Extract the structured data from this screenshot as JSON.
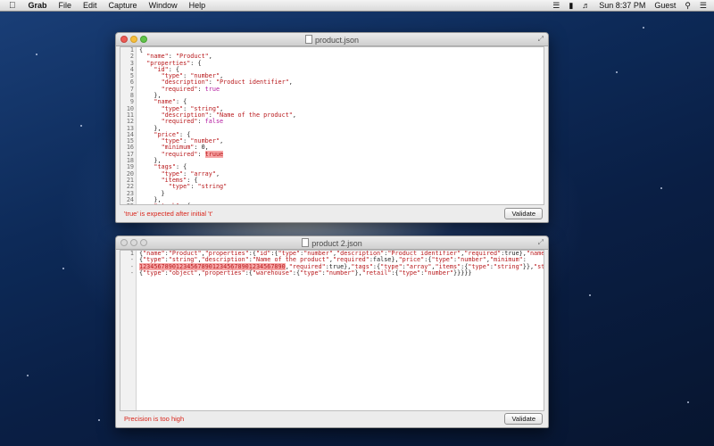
{
  "menubar": {
    "apple": "",
    "app_name": "Grab",
    "menus": [
      "File",
      "Edit",
      "Capture",
      "Window",
      "Help"
    ],
    "clock": "Sun 8:37 PM",
    "user": "Guest"
  },
  "windows": [
    {
      "title": "product.json",
      "active": true,
      "line_numbers": [
        "1",
        "2",
        "3",
        "4",
        "5",
        "6",
        "7",
        "8",
        "9",
        "10",
        "11",
        "12",
        "13",
        "14",
        "15",
        "16",
        "17",
        "18",
        "19",
        "20",
        "21",
        "22",
        "23",
        "24",
        "25",
        "26"
      ],
      "error_message": "'true' is expected after initial 't'",
      "validate_label": "Validate"
    },
    {
      "title": "product 2.json",
      "active": false,
      "line_numbers": [
        "1",
        "-",
        "-",
        "-"
      ],
      "error_message": "Precision is too high",
      "validate_label": "Validate"
    }
  ],
  "code1": [
    [
      {
        "t": "{",
        "c": "n"
      }
    ],
    [
      {
        "t": "  ",
        "c": "n"
      },
      {
        "t": "\"name\"",
        "c": "k"
      },
      {
        "t": ": ",
        "c": "n"
      },
      {
        "t": "\"Product\"",
        "c": "s"
      },
      {
        "t": ",",
        "c": "n"
      }
    ],
    [
      {
        "t": "  ",
        "c": "n"
      },
      {
        "t": "\"properties\"",
        "c": "k"
      },
      {
        "t": ": {",
        "c": "n"
      }
    ],
    [
      {
        "t": "    ",
        "c": "n"
      },
      {
        "t": "\"id\"",
        "c": "k"
      },
      {
        "t": ": {",
        "c": "n"
      }
    ],
    [
      {
        "t": "      ",
        "c": "n"
      },
      {
        "t": "\"type\"",
        "c": "k"
      },
      {
        "t": ": ",
        "c": "n"
      },
      {
        "t": "\"number\"",
        "c": "s"
      },
      {
        "t": ",",
        "c": "n"
      }
    ],
    [
      {
        "t": "      ",
        "c": "n"
      },
      {
        "t": "\"description\"",
        "c": "k"
      },
      {
        "t": ": ",
        "c": "n"
      },
      {
        "t": "\"Product identifier\"",
        "c": "s"
      },
      {
        "t": ",",
        "c": "n"
      }
    ],
    [
      {
        "t": "      ",
        "c": "n"
      },
      {
        "t": "\"required\"",
        "c": "k"
      },
      {
        "t": ": ",
        "c": "n"
      },
      {
        "t": "true",
        "c": "b"
      }
    ],
    [
      {
        "t": "    },",
        "c": "n"
      }
    ],
    [
      {
        "t": "    ",
        "c": "n"
      },
      {
        "t": "\"name\"",
        "c": "k"
      },
      {
        "t": ": {",
        "c": "n"
      }
    ],
    [
      {
        "t": "      ",
        "c": "n"
      },
      {
        "t": "\"type\"",
        "c": "k"
      },
      {
        "t": ": ",
        "c": "n"
      },
      {
        "t": "\"string\"",
        "c": "s"
      },
      {
        "t": ",",
        "c": "n"
      }
    ],
    [
      {
        "t": "      ",
        "c": "n"
      },
      {
        "t": "\"description\"",
        "c": "k"
      },
      {
        "t": ": ",
        "c": "n"
      },
      {
        "t": "\"Name of the product\"",
        "c": "s"
      },
      {
        "t": ",",
        "c": "n"
      }
    ],
    [
      {
        "t": "      ",
        "c": "n"
      },
      {
        "t": "\"required\"",
        "c": "k"
      },
      {
        "t": ": ",
        "c": "n"
      },
      {
        "t": "false",
        "c": "b"
      }
    ],
    [
      {
        "t": "    },",
        "c": "n"
      }
    ],
    [
      {
        "t": "    ",
        "c": "n"
      },
      {
        "t": "\"price\"",
        "c": "k"
      },
      {
        "t": ": {",
        "c": "n"
      }
    ],
    [
      {
        "t": "      ",
        "c": "n"
      },
      {
        "t": "\"type\"",
        "c": "k"
      },
      {
        "t": ": ",
        "c": "n"
      },
      {
        "t": "\"number\"",
        "c": "s"
      },
      {
        "t": ",",
        "c": "n"
      }
    ],
    [
      {
        "t": "      ",
        "c": "n"
      },
      {
        "t": "\"minimum\"",
        "c": "k"
      },
      {
        "t": ": 0,",
        "c": "n"
      }
    ],
    [
      {
        "t": "      ",
        "c": "n"
      },
      {
        "t": "\"required\"",
        "c": "k"
      },
      {
        "t": ": ",
        "c": "n"
      },
      {
        "t": "truue",
        "c": "err"
      }
    ],
    [
      {
        "t": "    },",
        "c": "n"
      }
    ],
    [
      {
        "t": "    ",
        "c": "n"
      },
      {
        "t": "\"tags\"",
        "c": "k"
      },
      {
        "t": ": {",
        "c": "n"
      }
    ],
    [
      {
        "t": "      ",
        "c": "n"
      },
      {
        "t": "\"type\"",
        "c": "k"
      },
      {
        "t": ": ",
        "c": "n"
      },
      {
        "t": "\"array\"",
        "c": "s"
      },
      {
        "t": ",",
        "c": "n"
      }
    ],
    [
      {
        "t": "      ",
        "c": "n"
      },
      {
        "t": "\"items\"",
        "c": "k"
      },
      {
        "t": ": {",
        "c": "n"
      }
    ],
    [
      {
        "t": "        ",
        "c": "n"
      },
      {
        "t": "\"type\"",
        "c": "k"
      },
      {
        "t": ": ",
        "c": "n"
      },
      {
        "t": "\"string\"",
        "c": "s"
      }
    ],
    [
      {
        "t": "      }",
        "c": "n"
      }
    ],
    [
      {
        "t": "    },",
        "c": "n"
      }
    ],
    [
      {
        "t": "    ",
        "c": "n"
      },
      {
        "t": "\"stock\"",
        "c": "k"
      },
      {
        "t": ": {",
        "c": "n"
      }
    ],
    [
      {
        "t": "      ",
        "c": "n"
      },
      {
        "t": "\"type\"",
        "c": "k"
      },
      {
        "t": ": ",
        "c": "n"
      },
      {
        "t": "\"object\"",
        "c": "s"
      }
    ]
  ],
  "code2": [
    [
      {
        "t": "{",
        "c": "n"
      },
      {
        "t": "\"name\"",
        "c": "k"
      },
      {
        "t": ":",
        "c": "n"
      },
      {
        "t": "\"Product\"",
        "c": "s"
      },
      {
        "t": ",",
        "c": "n"
      },
      {
        "t": "\"properties\"",
        "c": "k"
      },
      {
        "t": ":{",
        "c": "n"
      },
      {
        "t": "\"id\"",
        "c": "k"
      },
      {
        "t": ":{",
        "c": "n"
      },
      {
        "t": "\"type\"",
        "c": "k"
      },
      {
        "t": ":",
        "c": "n"
      },
      {
        "t": "\"number\"",
        "c": "s"
      },
      {
        "t": ",",
        "c": "n"
      },
      {
        "t": "\"description\"",
        "c": "k"
      },
      {
        "t": ":",
        "c": "n"
      },
      {
        "t": "\"Product identifier\"",
        "c": "s"
      },
      {
        "t": ",",
        "c": "n"
      },
      {
        "t": "\"required\"",
        "c": "k"
      },
      {
        "t": ":true},",
        "c": "n"
      },
      {
        "t": "\"name\"",
        "c": "k"
      },
      {
        "t": ":",
        "c": "n"
      }
    ],
    [
      {
        "t": "{",
        "c": "n"
      },
      {
        "t": "\"type\"",
        "c": "k"
      },
      {
        "t": ":",
        "c": "n"
      },
      {
        "t": "\"string\"",
        "c": "s"
      },
      {
        "t": ",",
        "c": "n"
      },
      {
        "t": "\"description\"",
        "c": "k"
      },
      {
        "t": ":",
        "c": "n"
      },
      {
        "t": "\"Name of the product\"",
        "c": "s"
      },
      {
        "t": ",",
        "c": "n"
      },
      {
        "t": "\"required\"",
        "c": "k"
      },
      {
        "t": ":false},",
        "c": "n"
      },
      {
        "t": "\"price\"",
        "c": "k"
      },
      {
        "t": ":{",
        "c": "n"
      },
      {
        "t": "\"type\"",
        "c": "k"
      },
      {
        "t": ":",
        "c": "n"
      },
      {
        "t": "\"number\"",
        "c": "s"
      },
      {
        "t": ",",
        "c": "n"
      },
      {
        "t": "\"minimum\"",
        "c": "k"
      },
      {
        "t": ":",
        "c": "n"
      }
    ],
    [
      {
        "t": "1234567890123456789012345678901234567890",
        "c": "err"
      },
      {
        "t": ",",
        "c": "n"
      },
      {
        "t": "\"required\"",
        "c": "k"
      },
      {
        "t": ":true},",
        "c": "n"
      },
      {
        "t": "\"tags\"",
        "c": "k"
      },
      {
        "t": ":{",
        "c": "n"
      },
      {
        "t": "\"type\"",
        "c": "k"
      },
      {
        "t": ":",
        "c": "n"
      },
      {
        "t": "\"array\"",
        "c": "s"
      },
      {
        "t": ",",
        "c": "n"
      },
      {
        "t": "\"items\"",
        "c": "k"
      },
      {
        "t": ":{",
        "c": "n"
      },
      {
        "t": "\"type\"",
        "c": "k"
      },
      {
        "t": ":",
        "c": "n"
      },
      {
        "t": "\"string\"",
        "c": "s"
      },
      {
        "t": "}},",
        "c": "n"
      },
      {
        "t": "\"stock\"",
        "c": "k"
      },
      {
        "t": ":",
        "c": "n"
      }
    ],
    [
      {
        "t": "{",
        "c": "n"
      },
      {
        "t": "\"type\"",
        "c": "k"
      },
      {
        "t": ":",
        "c": "n"
      },
      {
        "t": "\"object\"",
        "c": "s"
      },
      {
        "t": ",",
        "c": "n"
      },
      {
        "t": "\"properties\"",
        "c": "k"
      },
      {
        "t": ":{",
        "c": "n"
      },
      {
        "t": "\"warehouse\"",
        "c": "k"
      },
      {
        "t": ":{",
        "c": "n"
      },
      {
        "t": "\"type\"",
        "c": "k"
      },
      {
        "t": ":",
        "c": "n"
      },
      {
        "t": "\"number\"",
        "c": "s"
      },
      {
        "t": "},",
        "c": "n"
      },
      {
        "t": "\"retail\"",
        "c": "k"
      },
      {
        "t": ":{",
        "c": "n"
      },
      {
        "t": "\"type\"",
        "c": "k"
      },
      {
        "t": ":",
        "c": "n"
      },
      {
        "t": "\"number\"",
        "c": "s"
      },
      {
        "t": "}}}}}",
        "c": "n"
      }
    ]
  ]
}
